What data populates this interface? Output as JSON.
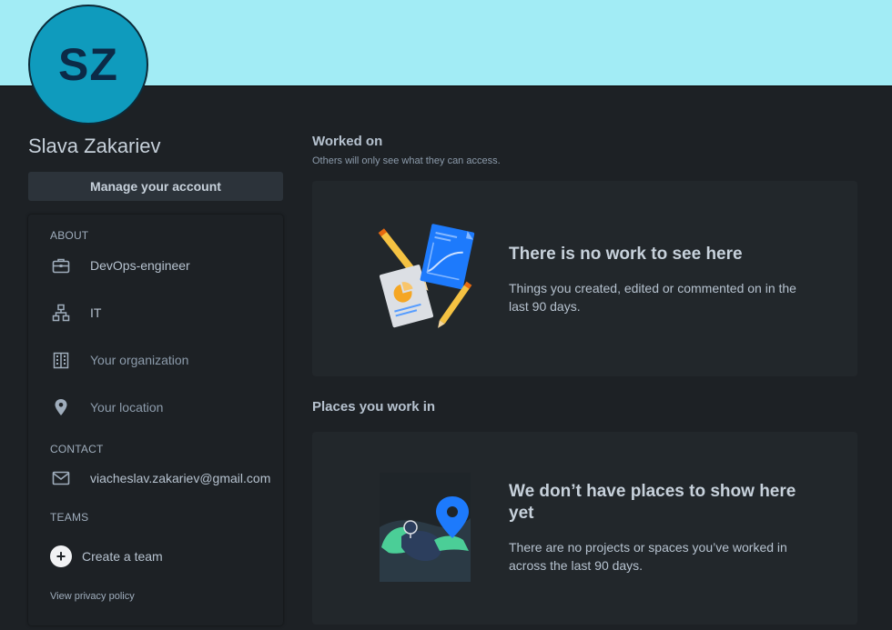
{
  "profile": {
    "initials": "SZ",
    "name": "Slava Zakariev",
    "manage_label": "Manage your account"
  },
  "about": {
    "title": "ABOUT",
    "job_title": "DevOps-engineer",
    "department": "IT",
    "organization": "Your organization",
    "location": "Your location"
  },
  "contact": {
    "title": "CONTACT",
    "email": "viacheslav.zakariev@gmail.com"
  },
  "teams": {
    "title": "TEAMS",
    "create_label": "Create a team"
  },
  "privacy_link": "View privacy policy",
  "worked_on": {
    "title": "Worked on",
    "subtitle": "Others will only see what they can access.",
    "empty_title": "There is no work to see here",
    "empty_text": "Things you created, edited or commented on in the last 90 days."
  },
  "places": {
    "title": "Places you work in",
    "empty_title": "We don’t have places to show here yet",
    "empty_text": "There are no projects or spaces you’ve worked in across the last 90 days."
  },
  "icons": [
    "briefcase-icon",
    "org-chart-icon",
    "building-icon",
    "location-pin-icon",
    "mail-icon",
    "plus-icon"
  ],
  "colors": {
    "banner": "#a2ecf5",
    "avatar": "#0f9bbd",
    "background": "#1d2125",
    "panel": "#22272b"
  }
}
